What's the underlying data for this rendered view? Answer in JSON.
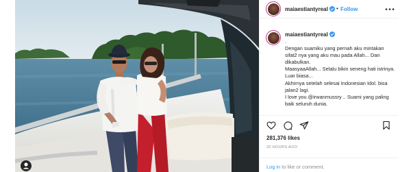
{
  "post": {
    "username": "maiaestiantyreal",
    "follow_label": "Follow",
    "header_separator": "•",
    "caption_username": "maiaestiantyreal",
    "caption_text": ". \nDengan suamiku yang pernah aku mintakan sifat2 nya yang aku mau pada Allah... Dan dikabulkan.\nMaasyaaAllah... Selalu bikin seneng hati istrinya. Luar biasa...\nAkhirnya setelah selesai Indonesian Idol. bisa jalan2 lagi.\nI love you @irwanmussry .. Suami yang paling baik seluruh dunia.",
    "likes": "281,376 likes",
    "time": "20 HOURS AGO",
    "login_link": "Log in",
    "login_rest": " to like or comment."
  },
  "icons": {
    "more": "more-horizontal-icon",
    "heart": "heart-icon",
    "comment": "comment-icon",
    "share": "share-icon",
    "save": "bookmark-icon",
    "verified": "verified-badge-icon",
    "profile_badge": "user-tag-icon"
  },
  "colors": {
    "link": "#3897f0",
    "muted": "#8e8e8e",
    "text": "#262626",
    "border": "#efefef",
    "avatar_ring": "#c13584"
  }
}
